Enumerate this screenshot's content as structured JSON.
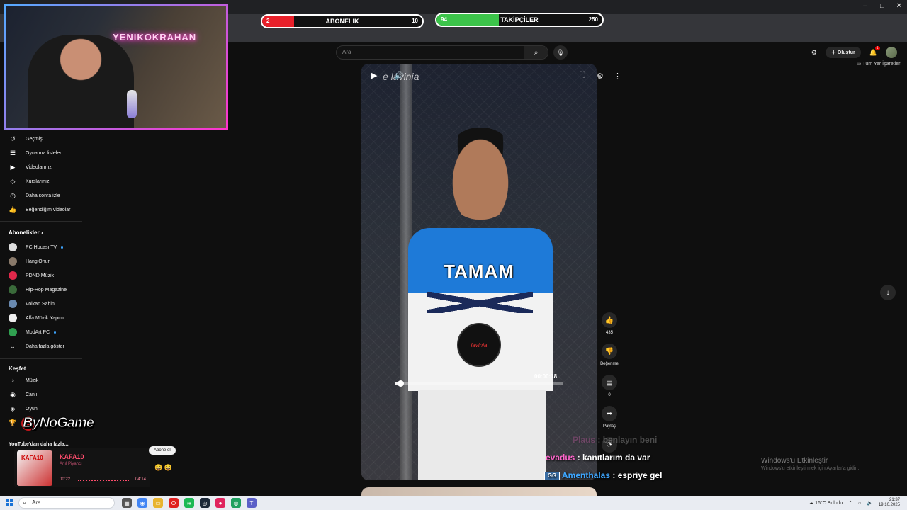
{
  "browser": {
    "window_controls": [
      "–",
      "□",
      "✕"
    ],
    "bookmarks_label": "Tüm Yer İşaretleri"
  },
  "overlays": {
    "subscribers": {
      "label": "ABONELİK",
      "current": "2",
      "target": "10",
      "progress": 0.2,
      "color": "#e8202a"
    },
    "followers": {
      "label": "TAKİPÇİLER",
      "current": "94",
      "target": "250",
      "progress": 0.376,
      "color": "#3cc44a"
    }
  },
  "youtube": {
    "search_placeholder": "Ara",
    "create_label": "Oluştur",
    "notification_count": "1"
  },
  "webcam": {
    "neon_sign": "YENIKOKRAHAN"
  },
  "sidebar": {
    "you_items": [
      {
        "label": "Geçmiş",
        "icon": "history-icon"
      },
      {
        "label": "Oynatma listeleri",
        "icon": "playlist-icon"
      },
      {
        "label": "Videolarınız",
        "icon": "your-videos-icon"
      },
      {
        "label": "Kurslarınız",
        "icon": "courses-icon"
      },
      {
        "label": "Daha sonra izle",
        "icon": "watch-later-icon"
      },
      {
        "label": "Beğendiğim videolar",
        "icon": "liked-icon"
      }
    ],
    "subscriptions_title": "Abonelikler",
    "channels": [
      {
        "label": "PC Hocası TV",
        "color": "#dddddd",
        "live": true
      },
      {
        "label": "HangiOnur",
        "color": "#8a7a6a",
        "live": false
      },
      {
        "label": "PDND Müzik",
        "color": "#e0284a",
        "live": false
      },
      {
        "label": "Hip-Hop Magazine",
        "color": "#3a6a3a",
        "live": false
      },
      {
        "label": "Volkan Sahin",
        "color": "#6a8ab0",
        "live": false
      },
      {
        "label": "Alfa Müzik Yapım",
        "color": "#eeeeee",
        "live": false
      },
      {
        "label": "ModArt PC",
        "color": "#30a050",
        "live": true
      }
    ],
    "show_more": "Daha fazla göster",
    "explore_title": "Keşfet",
    "explore_items": [
      {
        "label": "Müzik",
        "icon": "music-icon"
      },
      {
        "label": "Canlı",
        "icon": "live-icon"
      },
      {
        "label": "Oyun",
        "icon": "gaming-icon"
      }
    ],
    "more_from_youtube": "YouTube'dan daha fazla..."
  },
  "watermark": "ByNoGame",
  "music_widget": {
    "art_text": "KAFA10",
    "title": "KAFA10",
    "artist": "Anıl Piyancı",
    "elapsed": "00:22",
    "duration": "04:14",
    "progress": 0.087
  },
  "subscribe_tooltip": "Abone ol",
  "short": {
    "channel_name": "e lavinia",
    "caption": "TAMAM",
    "badge_text": "lavinia",
    "timestamp": "00:00:18",
    "progress": 0.03,
    "likes": "435",
    "dislike_label": "Beğenme",
    "comments": "0",
    "share_label": "Paylaş"
  },
  "chat": [
    {
      "user": "Plaus",
      "message": "benlayın beni",
      "faded": true
    },
    {
      "user": "evadus",
      "message": "kanıtlarım da var",
      "faded": false
    },
    {
      "user": "Amenthalas",
      "message": "espriye gel",
      "faded": false,
      "emote": "GG"
    }
  ],
  "windows_activation": {
    "title": "Windows'u Etkinleştir",
    "subtitle": "Windows'u etkinleştirmek için Ayarlar'a gidin."
  },
  "taskbar": {
    "search_placeholder": "Ara",
    "weather": "16°C  Bulutlu",
    "time": "21:37",
    "date": "19.10.2025"
  }
}
